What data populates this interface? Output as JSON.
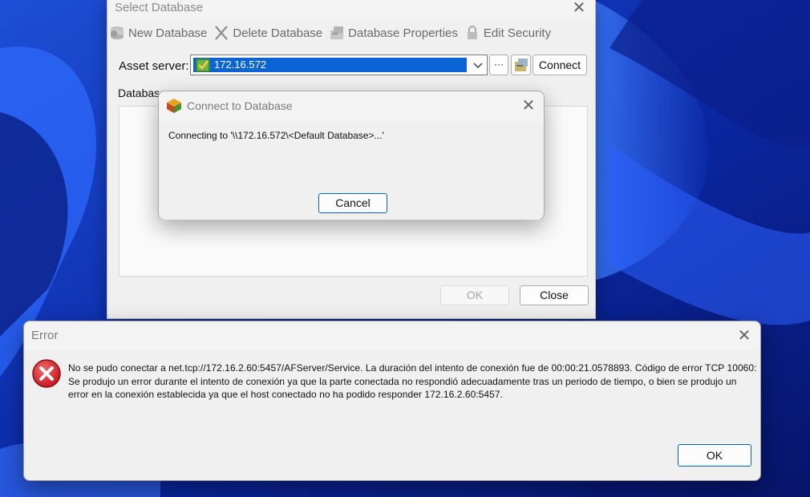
{
  "select_db": {
    "title": "Select Database",
    "toolbar": {
      "new_db": "New Database",
      "delete_db": "Delete Database",
      "db_props": "Database Properties",
      "edit_security": "Edit Security"
    },
    "asset_server_label": "Asset server:",
    "asset_server_value": "172.16.572",
    "browse_label": "···",
    "connect_label": "Connect",
    "databases_label": "Databases:",
    "ok_label": "OK",
    "close_label": "Close"
  },
  "connect_dialog": {
    "title": "Connect to Database",
    "message": "Connecting to '\\\\172.16.572\\<Default Database>...'",
    "cancel_label": "Cancel"
  },
  "error_dialog": {
    "title": "Error",
    "message": "No se pudo conectar a net.tcp://172.16.2.60:5457/AFServer/Service. La duración del intento de conexión fue de 00:00:21.0578893. Código de error TCP 10060: Se produjo un error durante el intento de conexión ya que la parte conectada no respondió adecuadamente tras un periodo de tiempo, o bien se produjo un error en la conexión establecida ya que el host conectado no ha podido responder 172.16.2.60:5457.",
    "ok_label": "OK"
  },
  "icons": {
    "close": "close-icon",
    "new_db": "new-database-icon",
    "delete_db": "delete-x-icon",
    "db_props": "database-properties-icon",
    "edit_security": "lock-icon",
    "server": "server-icon",
    "dropdown": "chevron-down-icon",
    "properties_btn": "properties-icon",
    "app": "af-cube-icon",
    "error": "error-circle-x-icon"
  },
  "colors": {
    "selection": "#0a64d6",
    "accent_border": "#0067c0",
    "error_red": "#d8232a",
    "wallpaper": "#0a1a6a"
  }
}
